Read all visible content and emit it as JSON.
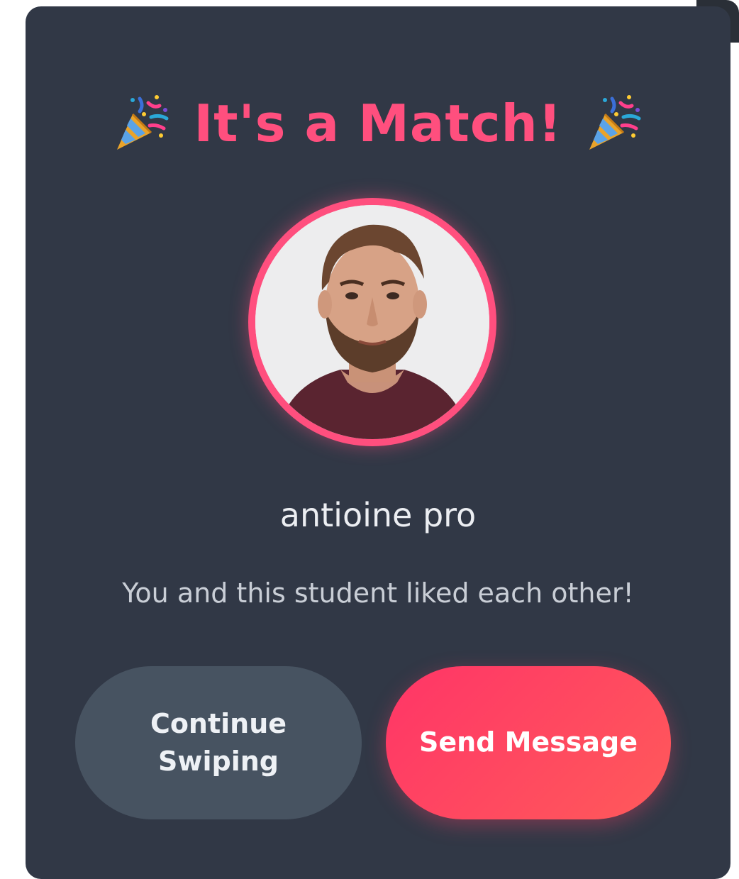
{
  "match": {
    "title": "It's a Match!",
    "left_icon": "party-popper-icon",
    "right_icon": "party-popper-icon",
    "accent_color": "#ff4f7e",
    "background_color": "#313846"
  },
  "profile": {
    "name": "antioine pro",
    "subtitle": "You and this student liked each other!",
    "avatar_icon": "profile-photo"
  },
  "actions": {
    "continue_label": "Continue Swiping",
    "send_label": "Send Message"
  }
}
